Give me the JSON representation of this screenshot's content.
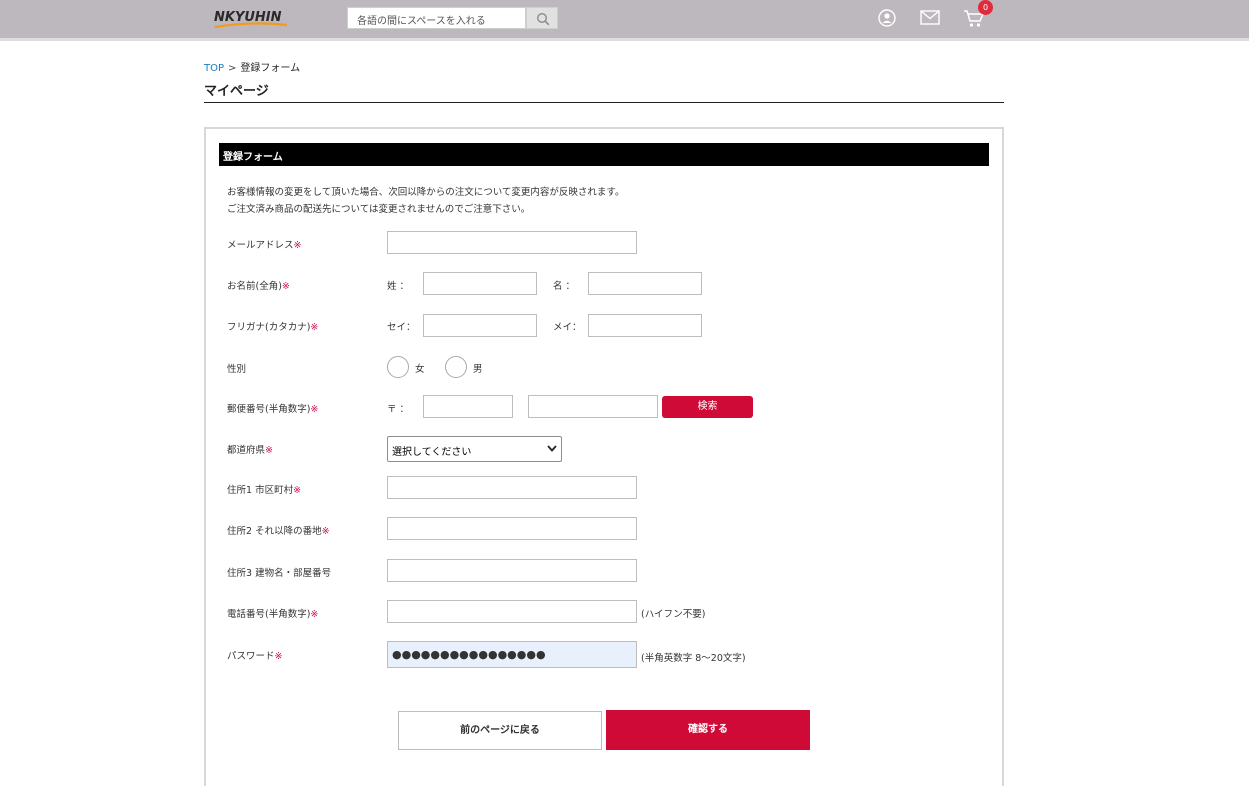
{
  "header": {
    "logo_text": "NKYUHIN",
    "search_placeholder": "各語の間にスペースを入れる",
    "cart_count": "0"
  },
  "breadcrumb": {
    "top": "TOP",
    "separator": ">",
    "current": "登録フォーム"
  },
  "page_title": "マイページ",
  "form": {
    "heading": "登録フォーム",
    "notice_line1": "お客様情報の変更をして頂いた場合、次回以降からの注文について変更内容が反映されます。",
    "notice_line2": "ご注文済み商品の配送先については変更されませんのでご注意下さい。",
    "required_mark": "※",
    "email_label": "メールアドレス",
    "name_label": "お名前(全角)",
    "last_name_sub": "姓 ：",
    "first_name_sub": "名 ：",
    "kana_label": "フリガナ(カタカナ)",
    "last_kana_sub": "セイ：",
    "first_kana_sub": "メイ：",
    "gender_label": "性別",
    "gender_female": "女",
    "gender_male": "男",
    "zip_label": "郵便番号(半角数字)",
    "zip_sub": "〒 ：",
    "zip_search_button": "検索",
    "pref_label": "都道府県",
    "pref_selected": "選択してください",
    "addr1_label": "住所1 市区町村",
    "addr2_label": "住所2 それ以降の番地",
    "addr3_label": "住所3 建物名・部屋番号",
    "phone_label": "電話番号(半角数字)",
    "phone_hint": "(ハイフン不要)",
    "password_label": "パスワード",
    "password_value": "●●●●●●●●●●●●●●●●",
    "password_hint": "(半角英数字 8～20文字)",
    "back_button": "前のページに戻る",
    "confirm_button": "確認する"
  },
  "colors": {
    "header_bg": "#bdb8bd",
    "accent_red": "#cf0a36",
    "link_blue": "#1a7fbf",
    "required_red": "#d0124a"
  }
}
